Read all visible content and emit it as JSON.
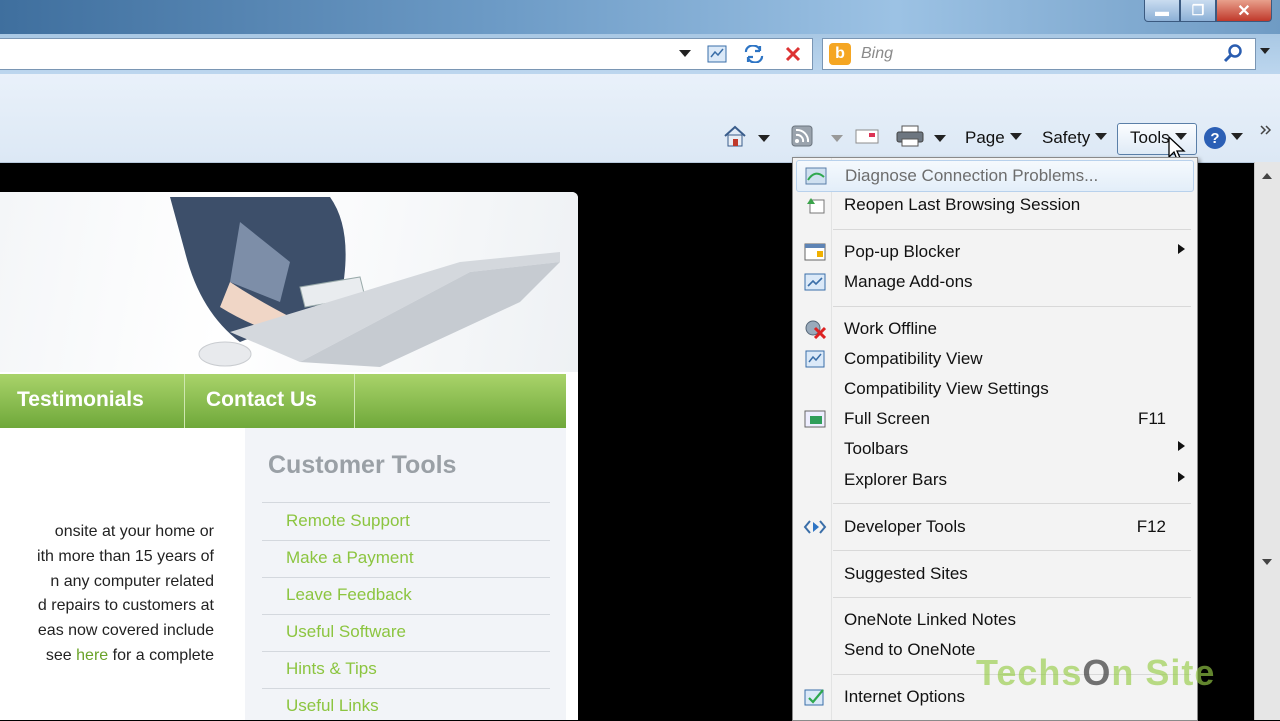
{
  "window": {
    "controls": {
      "minimize": "▬",
      "maximize": "❐",
      "close": "✕"
    }
  },
  "search": {
    "placeholder": "Bing",
    "provider_icon": "bing-icon",
    "provider_glyph": "b"
  },
  "commandbar": {
    "page_label": "Page",
    "safety_label": "Safety",
    "tools_label": "Tools",
    "help_glyph": "?"
  },
  "webpage": {
    "nav": [
      "Testimonials",
      "Contact Us"
    ],
    "sidebar_title": "Customer Tools",
    "sidebar_links": [
      "Remote Support",
      "Make a Payment",
      "Leave Feedback",
      "Useful Software",
      "Hints & Tips",
      "Useful Links"
    ],
    "body_lines": [
      "onsite at your home or",
      "ith more than 15 years of",
      "n any computer related",
      "d repairs to customers at",
      "eas now covered include"
    ],
    "body_last_pre": "see ",
    "body_last_link": "here",
    "body_last_post": " for a complete"
  },
  "tools_menu": {
    "items": [
      {
        "label": "Diagnose Connection Problems...",
        "icon": "diagnose-icon",
        "disabled": true
      },
      {
        "label": "Reopen Last Browsing Session",
        "icon": "reopen-icon"
      },
      {
        "label": "Pop-up Blocker",
        "icon": "popup-icon",
        "submenu": true
      },
      {
        "label": "Manage Add-ons",
        "icon": "addons-icon"
      },
      {
        "label": "Work Offline",
        "icon": "offline-icon"
      },
      {
        "label": "Compatibility View",
        "icon": "compatibility-icon"
      },
      {
        "label": "Compatibility View Settings"
      },
      {
        "label": "Full Screen",
        "icon": "fullscreen-icon",
        "shortcut": "F11"
      },
      {
        "label": "Toolbars",
        "submenu": true
      },
      {
        "label": "Explorer Bars",
        "submenu": true
      },
      {
        "label": "Developer Tools",
        "icon": "developer-icon",
        "shortcut": "F12"
      },
      {
        "label": "Suggested Sites"
      },
      {
        "label": "OneNote Linked Notes"
      },
      {
        "label": "Send to OneNote"
      },
      {
        "label": "Internet Options",
        "icon": "options-icon"
      }
    ]
  },
  "watermark": {
    "part1": "Techs",
    "part2": "O",
    "part3": "n Site"
  }
}
